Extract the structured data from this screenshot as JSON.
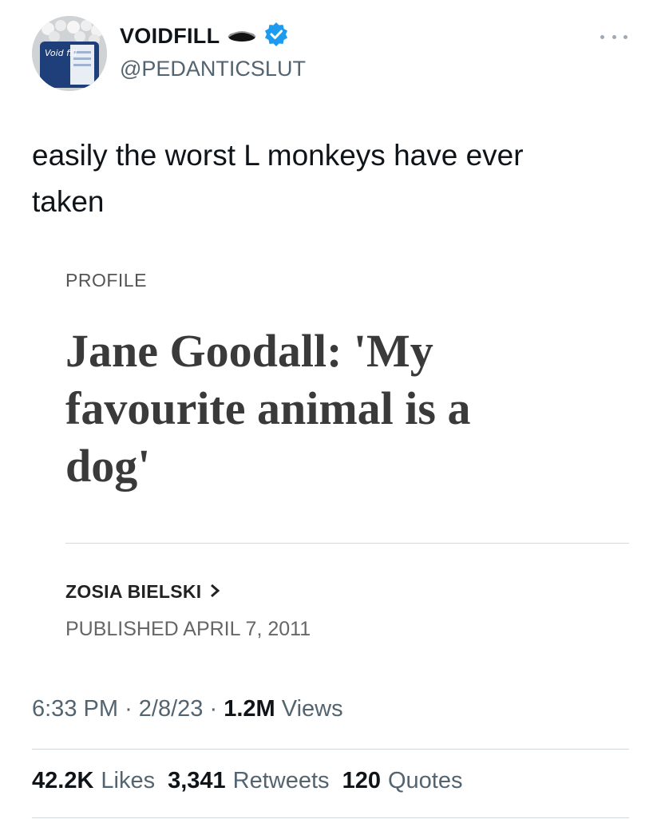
{
  "tweet": {
    "display_name": "VOIDFILL",
    "handle": "@PEDANTICSLUT",
    "verified_color": "#1d9bf0",
    "more_icon": "ellipsis-icon",
    "avatar_label": "Void fill",
    "text_line1": "easily the worst L monkeys have ever",
    "text_line2": "taken"
  },
  "card": {
    "kicker": "PROFILE",
    "headline_lines": [
      "Jane Goodall: 'My",
      "favourite animal is a",
      "dog'"
    ],
    "author": "ZOSIA BIELSKI",
    "published": "PUBLISHED APRIL 7, 2011"
  },
  "meta": {
    "time": "6:33 PM",
    "date": "2/8/23",
    "sep": "·",
    "views_count": "1.2M",
    "views_label": "Views"
  },
  "stats": {
    "likes_count": "42.2K",
    "likes_label": "Likes",
    "retweets_count": "3,341",
    "retweets_label": "Retweets",
    "quotes_count": "120",
    "quotes_label": "Quotes"
  }
}
